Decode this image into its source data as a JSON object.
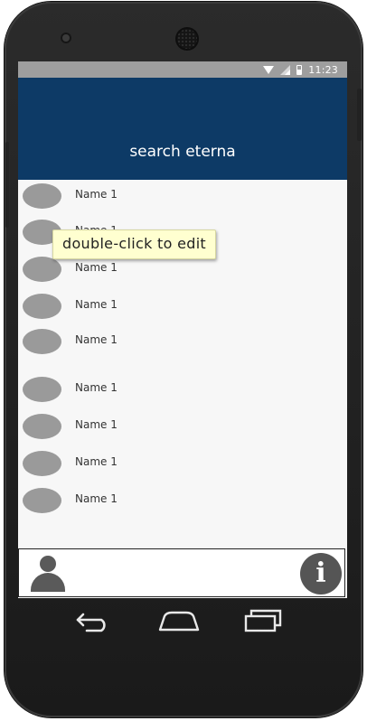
{
  "status_bar": {
    "time": "11:23",
    "icons": [
      "wifi-icon",
      "signal-icon",
      "battery-icon"
    ]
  },
  "header": {
    "title": "search eterna",
    "color": "#0d3a66"
  },
  "list": {
    "items": [
      {
        "name": "Name 1"
      },
      {
        "name": "Name 1"
      },
      {
        "name": "Name 1"
      },
      {
        "name": "Name 1"
      },
      {
        "name": "Name 1"
      },
      {
        "name": "Name 1"
      },
      {
        "name": "Name 1"
      },
      {
        "name": "Name 1"
      },
      {
        "name": "Name 1"
      }
    ]
  },
  "tooltip": {
    "text": "double-click to edit"
  },
  "bottom_bar": {
    "left_icon": "person-icon",
    "right_button_label": "i",
    "right_button_icon": "info-icon"
  },
  "nav_bar": {
    "icons": [
      "back-icon",
      "home-icon",
      "recent-apps-icon"
    ]
  }
}
